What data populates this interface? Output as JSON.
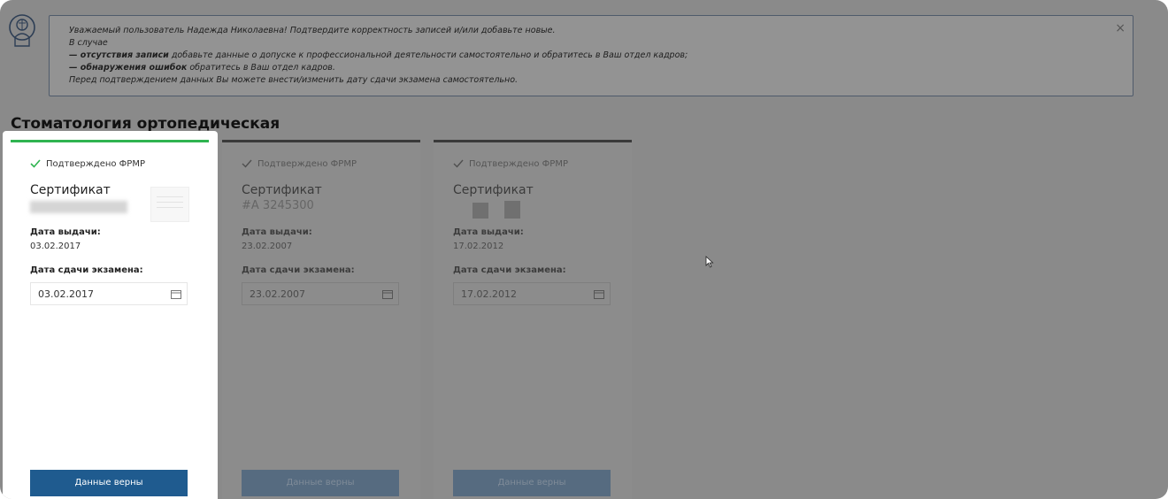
{
  "notice": {
    "line1": "Уважаемый пользователь Надежда Николаевна! Подтвердите корректность записей и/или добавьте новые.",
    "line2": "В случае",
    "line3_bold": "— отсутствия записи",
    "line3_rest": " добавьте данные о допуске к профессиональной деятельности самостоятельно и обратитесь в Ваш отдел кадров;",
    "line4_bold": "— обнаружения ошибок",
    "line4_rest": " обратитесь в Ваш отдел кадров.",
    "line5": "Перед подтверждением данных Вы можете внести/изменить дату сдачи экзамена самостоятельно.",
    "close_label": "×"
  },
  "section_title": "Стоматология ортопедическая",
  "cards": [
    {
      "status": "Подтверждено ФРМР",
      "title": "Сертификат",
      "number": "",
      "issue_label": "Дата выдачи:",
      "issue_date": "03.02.2017",
      "exam_label": "Дата сдачи экзамена:",
      "exam_date": "03.02.2017",
      "button": "Данные верны"
    },
    {
      "status": "Подтверждено ФРМР",
      "title": "Сертификат",
      "number": "#А 3245300",
      "issue_label": "Дата выдачи:",
      "issue_date": "23.02.2007",
      "exam_label": "Дата сдачи экзамена:",
      "exam_date": "23.02.2007",
      "button": "Данные верны"
    },
    {
      "status": "Подтверждено ФРМР",
      "title": "Сертификат",
      "number": "",
      "issue_label": "Дата выдачи:",
      "issue_date": "17.02.2012",
      "exam_label": "Дата сдачи экзамена:",
      "exam_date": "17.02.2012",
      "button": "Данные верны"
    }
  ],
  "colors": {
    "accent_active": "#2fb450",
    "button": "#1f5b8f",
    "overlay": "#8a8a8a"
  }
}
